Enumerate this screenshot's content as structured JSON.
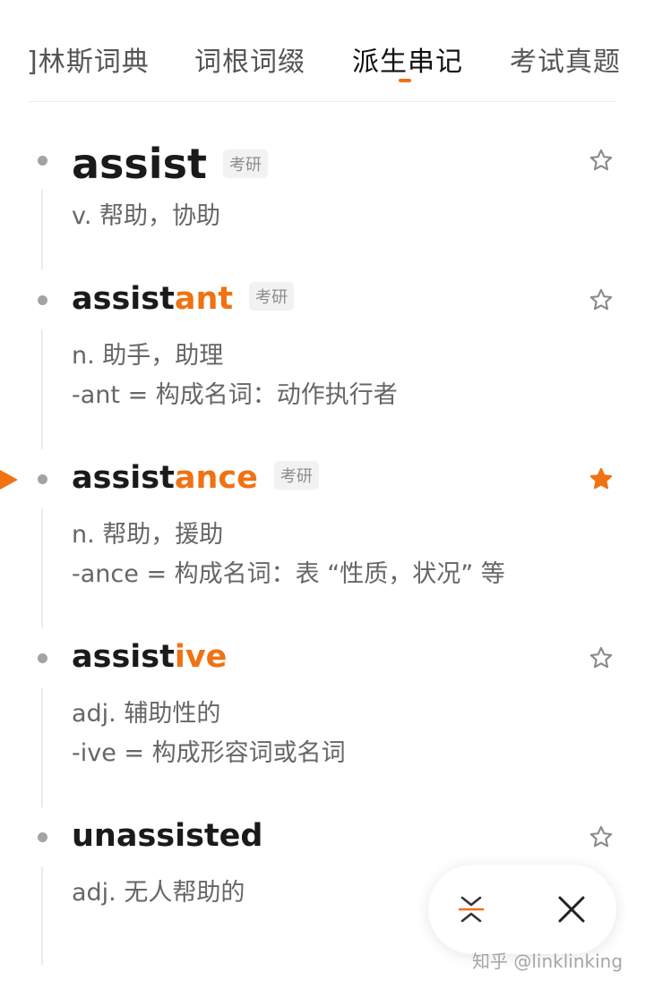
{
  "tabs": [
    {
      "label": "]林斯词典",
      "active": false
    },
    {
      "label": "词根词缀",
      "active": false
    },
    {
      "label": "派生串记",
      "active": true
    },
    {
      "label": "考试真题",
      "active": false
    }
  ],
  "entries": [
    {
      "base": "assist",
      "suffix": "",
      "tag": "考研",
      "definitions": [
        "v. 帮助，协助"
      ],
      "starred": false,
      "current": false
    },
    {
      "base": "assist",
      "suffix": "ant",
      "tag": "考研",
      "definitions": [
        "n. 助手，助理",
        "-ant = 构成名词：动作执行者"
      ],
      "starred": false,
      "current": false
    },
    {
      "base": "assist",
      "suffix": "ance",
      "tag": "考研",
      "definitions": [
        "n. 帮助，援助",
        "-ance = 构成名词：表 “性质，状况” 等"
      ],
      "starred": true,
      "current": true
    },
    {
      "base": "assist",
      "suffix": "ive",
      "tag": "",
      "definitions": [
        "adj. 辅助性的",
        "-ive = 构成形容词或名词"
      ],
      "starred": false,
      "current": false
    },
    {
      "base": "unassisted",
      "suffix": "",
      "tag": "",
      "definitions": [
        "adj. 无人帮助的"
      ],
      "starred": false,
      "current": false
    }
  ],
  "fab": {
    "collapse_icon": "collapse-icon",
    "close_icon": "close-icon"
  },
  "watermark": "知乎 @linklinking",
  "colors": {
    "accent": "#f07212",
    "bullet": "#a3a3a3",
    "definition": "#666666"
  }
}
